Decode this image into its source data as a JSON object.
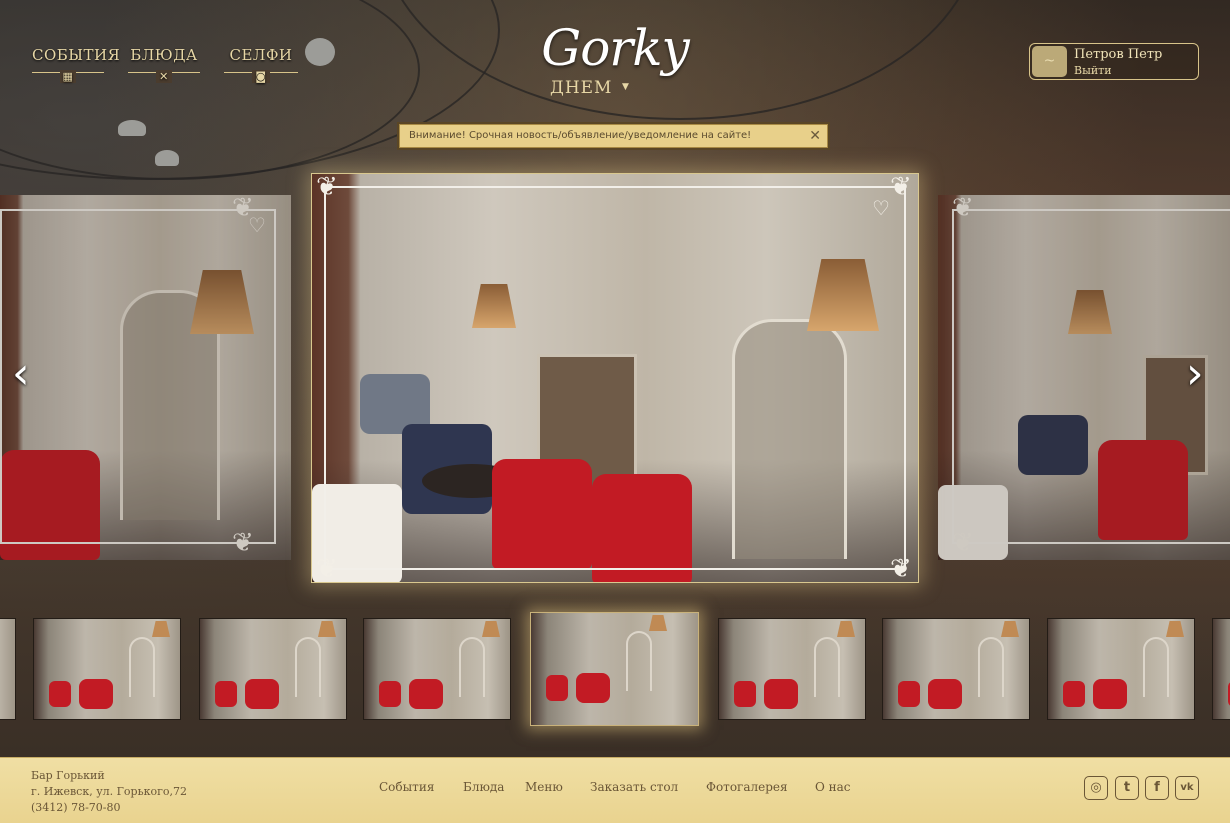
{
  "nav": {
    "items": [
      {
        "label": "СОБЫТИЯ",
        "icon": "calendar-icon"
      },
      {
        "label": "БЛЮДА",
        "icon": "cutlery-icon"
      },
      {
        "label": "СЕЛФИ",
        "icon": "camera-icon"
      }
    ]
  },
  "logo": {
    "script": "Gorky",
    "mode": "ДНЕМ"
  },
  "user": {
    "name": "Петров Петр",
    "logout": "Выйти",
    "avatar_icon": "mustache-icon"
  },
  "notice": {
    "text": "Внимание! Срочная новость/объявление/уведомление на сайте!"
  },
  "gallery": {
    "arrows": {
      "prev": "‹",
      "next": "›"
    },
    "thumbnail_count": 9,
    "active_thumbnail": 4
  },
  "footer": {
    "bar_name": "Бар Горький",
    "address": "г. Ижевск, ул. Горького,72",
    "phone": "(3412) 78-70-80",
    "links": [
      "События",
      "Блюда",
      "Меню",
      "Заказать стол",
      "Фотогалерея",
      "О нас"
    ],
    "social": [
      "instagram-icon",
      "twitter-icon",
      "facebook-icon",
      "vk-icon"
    ]
  },
  "colors": {
    "accent": "#e7d7a6",
    "footer_bg": "#ecd898",
    "notice_bg": "#e8d08a",
    "chair_red": "#c21b24"
  }
}
